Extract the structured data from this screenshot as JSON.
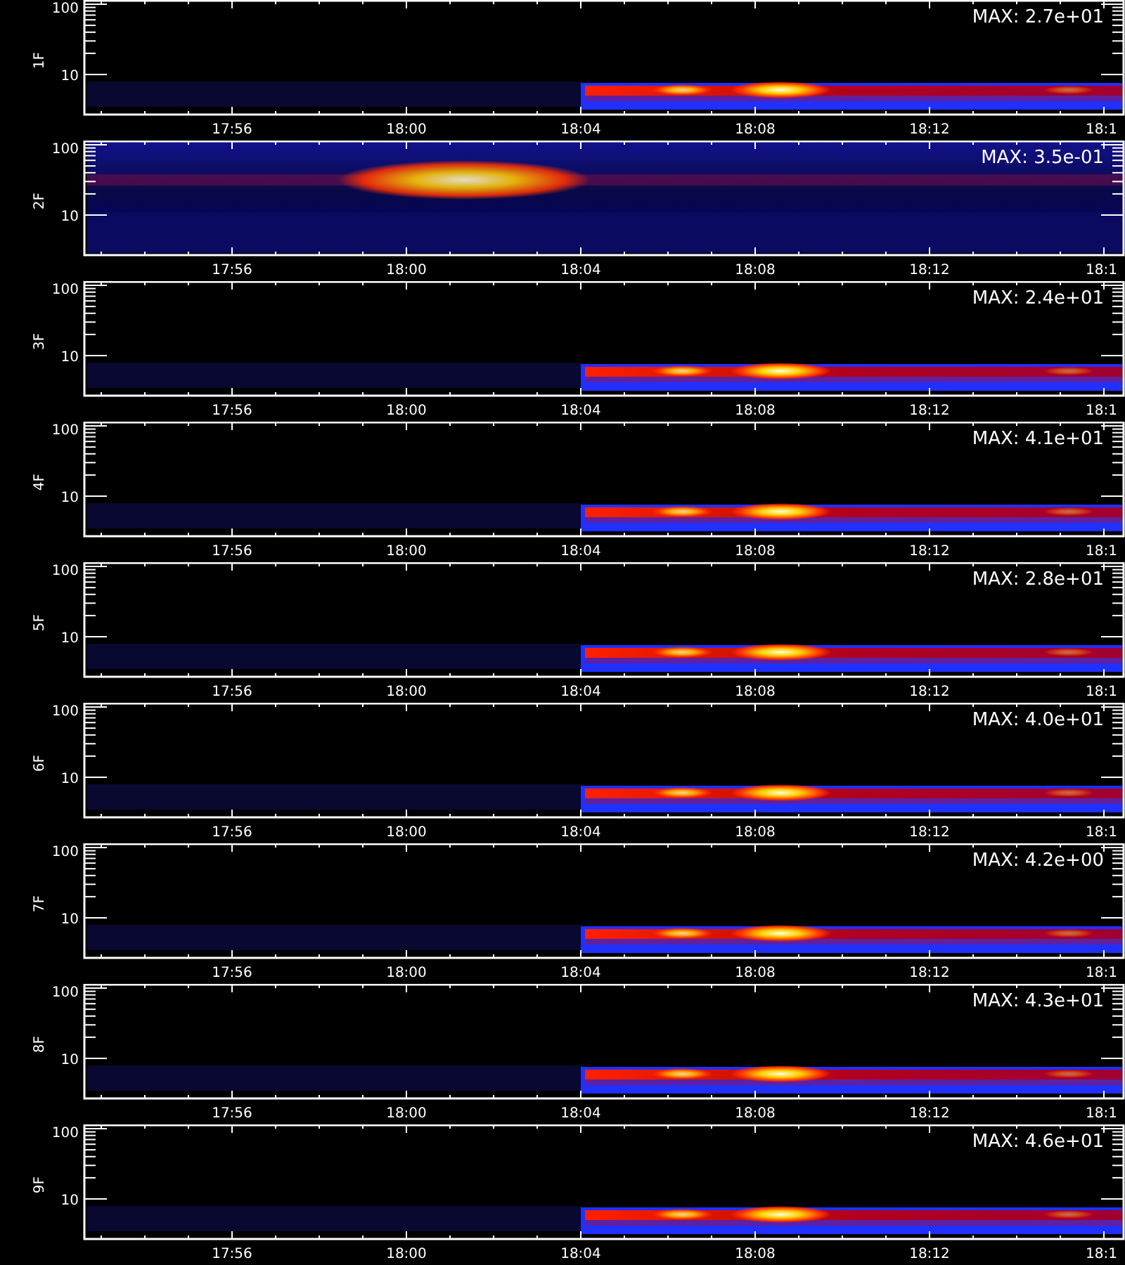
{
  "panels": [
    {
      "label": "1F",
      "kind": "band",
      "max": "MAX: 2.7e+01",
      "y_ticks": [
        "100",
        "10"
      ],
      "time_labels": [
        "17:56",
        "18:00",
        "18:04",
        "18:08",
        "18:12",
        "18:1"
      ]
    },
    {
      "label": "2F",
      "kind": "diffuse",
      "max": "MAX: 3.5e-01",
      "y_ticks": [
        "100",
        "10"
      ],
      "time_labels": [
        "17:56",
        "18:00",
        "18:04",
        "18:08",
        "18:12",
        "18:1"
      ]
    },
    {
      "label": "3F",
      "kind": "band",
      "max": "MAX: 2.4e+01",
      "y_ticks": [
        "100",
        "10"
      ],
      "time_labels": [
        "17:56",
        "18:00",
        "18:04",
        "18:08",
        "18:12",
        "18:1"
      ]
    },
    {
      "label": "4F",
      "kind": "band",
      "max": "MAX: 4.1e+01",
      "y_ticks": [
        "100",
        "10"
      ],
      "time_labels": [
        "17:56",
        "18:00",
        "18:04",
        "18:08",
        "18:12",
        "18:1"
      ]
    },
    {
      "label": "5F",
      "kind": "band",
      "max": "MAX: 2.8e+01",
      "y_ticks": [
        "100",
        "10"
      ],
      "time_labels": [
        "17:56",
        "18:00",
        "18:04",
        "18:08",
        "18:12",
        "18:1"
      ]
    },
    {
      "label": "6F",
      "kind": "band",
      "max": "MAX: 4.0e+01",
      "y_ticks": [
        "100",
        "10"
      ],
      "time_labels": [
        "17:56",
        "18:00",
        "18:04",
        "18:08",
        "18:12",
        "18:1"
      ]
    },
    {
      "label": "7F",
      "kind": "band",
      "max": "MAX: 4.2e+00",
      "y_ticks": [
        "100",
        "10"
      ],
      "time_labels": [
        "17:56",
        "18:00",
        "18:04",
        "18:08",
        "18:12",
        "18:1"
      ]
    },
    {
      "label": "8F",
      "kind": "band",
      "max": "MAX: 4.3e+01",
      "y_ticks": [
        "100",
        "10"
      ],
      "time_labels": [
        "17:56",
        "18:00",
        "18:04",
        "18:08",
        "18:12",
        "18:1"
      ]
    },
    {
      "label": "9F",
      "kind": "band",
      "max": "MAX: 4.6e+01",
      "y_ticks": [
        "100",
        "10"
      ],
      "time_labels": [
        "17:56",
        "18:00",
        "18:04",
        "18:08",
        "18:12",
        "18:1"
      ]
    }
  ]
}
